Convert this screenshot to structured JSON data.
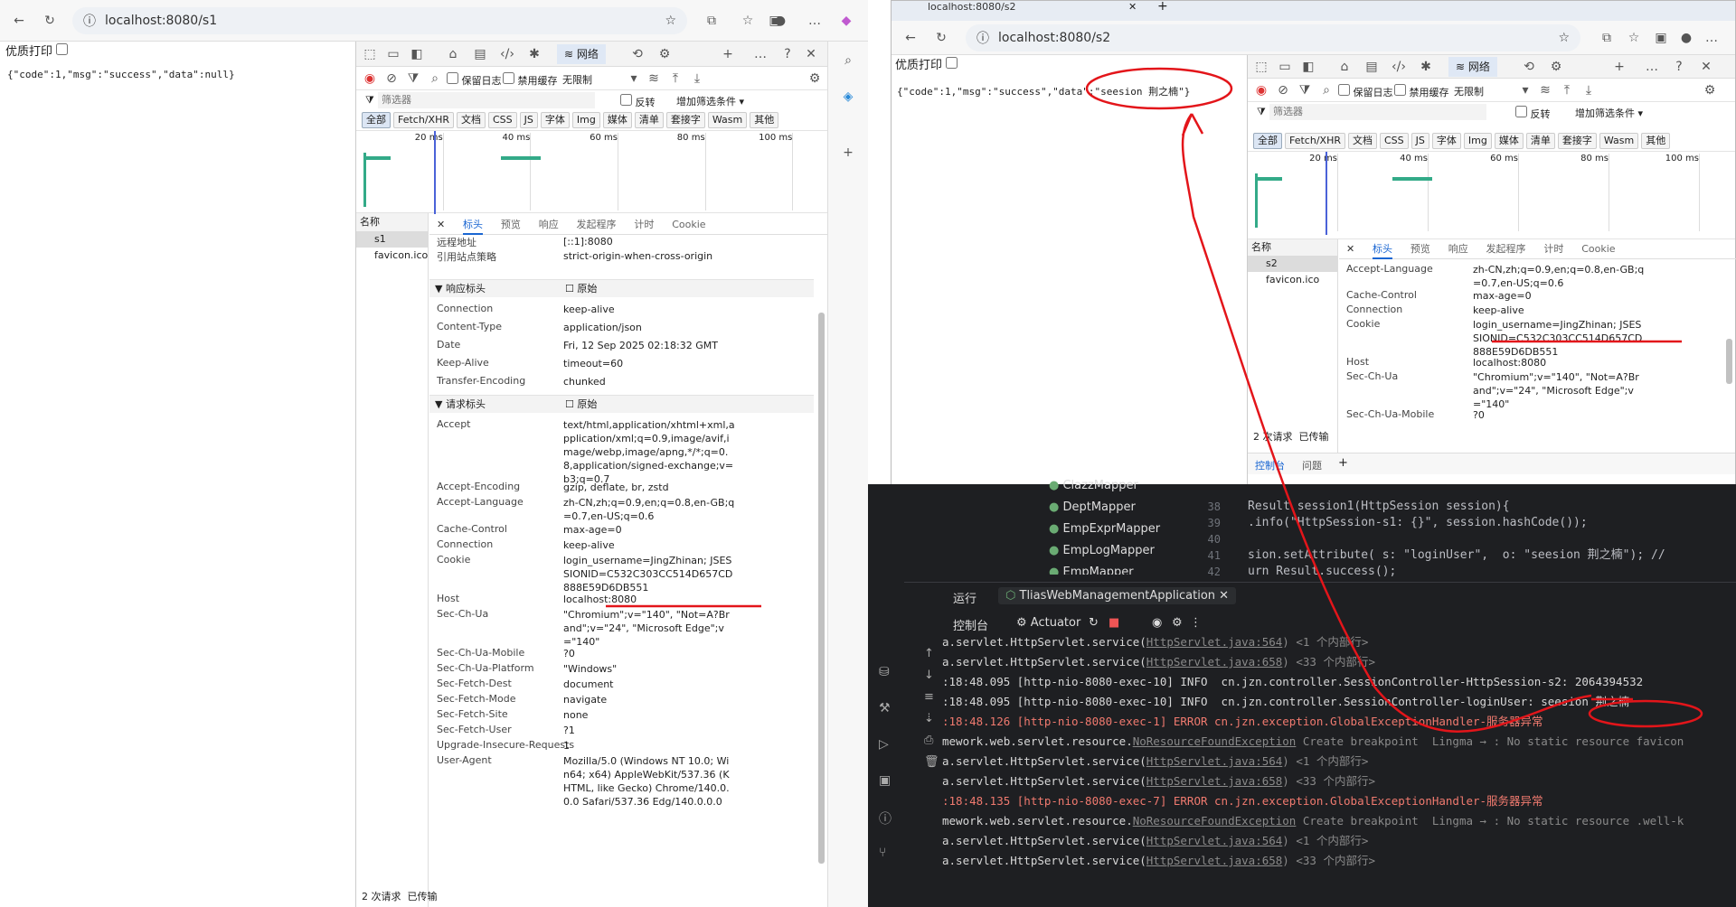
{
  "left": {
    "url": "localhost:8080/s1",
    "print_label": "优质打印",
    "body_json": "{\"code\":1,\"msg\":\"success\",\"data\":null}",
    "devtools": {
      "network_tab": "网络",
      "toolbar": {
        "preserve_log": "保留日志",
        "disable_cache": "禁用缓存",
        "throttle": "无限制"
      },
      "filter_placeholder": "筛选器",
      "invert": "反转",
      "more_filters": "增加筛选条件",
      "type_chips": [
        "全部",
        "Fetch/XHR",
        "文档",
        "CSS",
        "JS",
        "字体",
        "Img",
        "媒体",
        "清单",
        "套接字",
        "Wasm",
        "其他"
      ],
      "timeline_ticks": [
        "20 ms",
        "40 ms",
        "60 ms",
        "80 ms",
        "100 ms"
      ],
      "name_header": "名称",
      "requests": [
        "s1",
        "favicon.ico"
      ],
      "status": "2 次请求",
      "status2": "已传输",
      "subtabs": [
        "标头",
        "预览",
        "响应",
        "发起程序",
        "计时",
        "Cookie"
      ],
      "general": [
        {
          "k": "远程地址",
          "v": "[::1]:8080"
        },
        {
          "k": "引用站点策略",
          "v": "strict-origin-when-cross-origin"
        }
      ],
      "response_title": "▼ 响应标头",
      "raw_label": "原始",
      "response_headers": [
        {
          "k": "Connection",
          "v": "keep-alive"
        },
        {
          "k": "Content-Type",
          "v": "application/json"
        },
        {
          "k": "Date",
          "v": "Fri, 12 Sep 2025 02:18:32 GMT"
        },
        {
          "k": "Keep-Alive",
          "v": "timeout=60"
        },
        {
          "k": "Transfer-Encoding",
          "v": "chunked"
        }
      ],
      "request_title": "▼ 请求标头",
      "request_headers": [
        {
          "k": "Accept",
          "v": "text/html,application/xhtml+xml,application/xml;q=0.9,image/avif,image/webp,image/apng,*/*;q=0.8,application/signed-exchange;v=b3;q=0.7"
        },
        {
          "k": "Accept-Encoding",
          "v": "gzip, deflate, br, zstd"
        },
        {
          "k": "Accept-Language",
          "v": "zh-CN,zh;q=0.9,en;q=0.8,en-GB;q=0.7,en-US;q=0.6"
        },
        {
          "k": "Cache-Control",
          "v": "max-age=0"
        },
        {
          "k": "Connection",
          "v": "keep-alive"
        },
        {
          "k": "Cookie",
          "v": "login_username=JingZhinan; JSESSIONID=C532C303CC514D657CD888E59D6DB551"
        },
        {
          "k": "Host",
          "v": "localhost:8080"
        },
        {
          "k": "Sec-Ch-Ua",
          "v": "\"Chromium\";v=\"140\", \"Not=A?Brand\";v=\"24\", \"Microsoft Edge\";v=\"140\""
        },
        {
          "k": "Sec-Ch-Ua-Mobile",
          "v": "?0"
        },
        {
          "k": "Sec-Ch-Ua-Platform",
          "v": "\"Windows\""
        },
        {
          "k": "Sec-Fetch-Dest",
          "v": "document"
        },
        {
          "k": "Sec-Fetch-Mode",
          "v": "navigate"
        },
        {
          "k": "Sec-Fetch-Site",
          "v": "none"
        },
        {
          "k": "Sec-Fetch-User",
          "v": "?1"
        },
        {
          "k": "Upgrade-Insecure-Requests",
          "v": "1"
        },
        {
          "k": "User-Agent",
          "v": "Mozilla/5.0 (Windows NT 10.0; Win64; x64) AppleWebKit/537.36 (KHTML, like Gecko) Chrome/140.0.0.0 Safari/537.36 Edg/140.0.0.0"
        }
      ]
    }
  },
  "right": {
    "tab_title": "localhost:8080/s2",
    "url": "localhost:8080/s2",
    "print_label": "优质打印",
    "body_json": "{\"code\":1,\"msg\":\"success\",\"data\":\"seesion 荆之楠\"}",
    "devtools": {
      "network_tab": "网络",
      "toolbar": {
        "preserve_log": "保留日志",
        "disable_cache": "禁用缓存",
        "throttle": "无限制"
      },
      "filter_placeholder": "筛选器",
      "invert": "反转",
      "more_filters": "增加筛选条件",
      "type_chips": [
        "全部",
        "Fetch/XHR",
        "文档",
        "CSS",
        "JS",
        "字体",
        "Img",
        "媒体",
        "清单",
        "套接字",
        "Wasm",
        "其他"
      ],
      "timeline_ticks": [
        "20 ms",
        "40 ms",
        "60 ms",
        "80 ms",
        "100 ms"
      ],
      "name_header": "名称",
      "requests": [
        "s2",
        "favicon.ico"
      ],
      "status": "2 次请求",
      "status2": "已传输",
      "subtabs": [
        "标头",
        "预览",
        "响应",
        "发起程序",
        "计时",
        "Cookie"
      ],
      "headers": [
        {
          "k": "Accept-Language",
          "v": "zh-CN,zh;q=0.9,en;q=0.8,en-GB;q=0.7,en-US;q=0.6"
        },
        {
          "k": "Cache-Control",
          "v": "max-age=0"
        },
        {
          "k": "Connection",
          "v": "keep-alive"
        },
        {
          "k": "Cookie",
          "v": "login_username=JingZhinan; JSESSIONID=C532C303CC514D657CD888E59D6DB551"
        },
        {
          "k": "Host",
          "v": "localhost:8080"
        },
        {
          "k": "Sec-Ch-Ua",
          "v": "\"Chromium\";v=\"140\", \"Not=A?Brand\";v=\"24\", \"Microsoft Edge\";v=\"140\""
        },
        {
          "k": "Sec-Ch-Ua-Mobile",
          "v": "?0"
        }
      ],
      "drawer_tabs": [
        "控制台",
        "问题"
      ]
    }
  },
  "ide": {
    "tree": [
      "ClazzMapper",
      "DeptMapper",
      "EmpExprMapper",
      "EmpLogMapper",
      "EmpMapper"
    ],
    "gutter": [
      "38",
      "39",
      "40",
      "41",
      "42"
    ],
    "code": [
      "Result session1(HttpSession session){",
      ".info(\"HttpSession-s1: {}\", session.hashCode());",
      "",
      "sion.setAttribute( s: \"loginUser\",  o: \"seesion 荆之楠\"); //",
      "urn Result.success();"
    ],
    "run_label": "运行",
    "run_config": "TliasWebManagementApplication",
    "console_tab": "控制台",
    "actuator_tab": "Actuator",
    "logs": [
      {
        "t": "a.servlet.HttpServlet.service(",
        "link": "HttpServlet.java:564",
        "tail": ") <1 个内部行>"
      },
      {
        "t": "a.servlet.HttpServlet.service(",
        "link": "HttpServlet.java:658",
        "tail": ") <33 个内部行>"
      },
      {
        "t": ":18:48.095 [http-nio-8080-exec-10] INFO  cn.jzn.controller.SessionController-HttpSession-s2: 2064394532",
        "link": "",
        "tail": ""
      },
      {
        "t": ":18:48.095 [http-nio-8080-exec-10] INFO  cn.jzn.controller.SessionController-loginUser: seesion 荆之楠",
        "link": "",
        "tail": ""
      },
      {
        "t": ":18:48.126 [http-nio-8080-exec-1] ERROR cn.jzn.exception.GlobalExceptionHandler-服务器异常",
        "link": "",
        "tail": ""
      },
      {
        "t": "mework.web.servlet.resource.",
        "link": "NoResourceFoundException",
        "tail": " Create breakpoint  Lingma → : No static resource favicon"
      },
      {
        "t": "a.servlet.HttpServlet.service(",
        "link": "HttpServlet.java:564",
        "tail": ") <1 个内部行>"
      },
      {
        "t": "a.servlet.HttpServlet.service(",
        "link": "HttpServlet.java:658",
        "tail": ") <33 个内部行>"
      },
      {
        "t": ":18:48.135 [http-nio-8080-exec-7] ERROR cn.jzn.exception.GlobalExceptionHandler-服务器异常",
        "link": "",
        "tail": ""
      },
      {
        "t": "mework.web.servlet.resource.",
        "link": "NoResourceFoundException",
        "tail": " Create breakpoint  Lingma → : No static resource .well-k"
      },
      {
        "t": "a.servlet.HttpServlet.service(",
        "link": "HttpServlet.java:564",
        "tail": ") <1 个内部行>"
      },
      {
        "t": "a.servlet.HttpServlet.service(",
        "link": "HttpServlet.java:658",
        "tail": ") <33 个内部行>"
      }
    ]
  },
  "colors": {
    "accent": "#1a66d2",
    "annotation": "#e3151a",
    "ide_bg": "#1e1f22"
  }
}
